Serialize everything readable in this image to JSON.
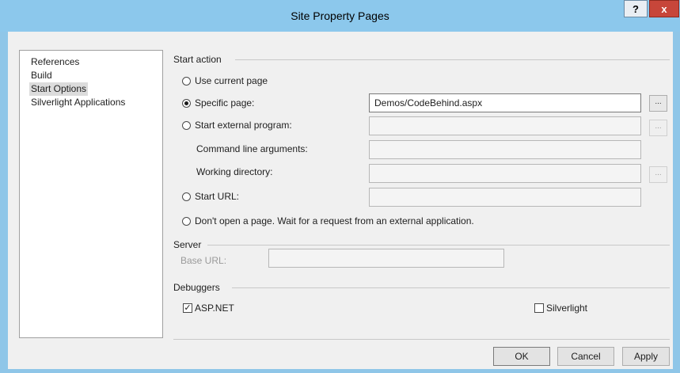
{
  "window": {
    "title": "Site Property Pages",
    "help_label": "?",
    "close_label": "x"
  },
  "nav": {
    "items": [
      {
        "label": "References"
      },
      {
        "label": "Build"
      },
      {
        "label": "Start Options",
        "selected": true
      },
      {
        "label": "Silverlight Applications"
      }
    ]
  },
  "start_action": {
    "group_title": "Start action",
    "use_current_page": {
      "label": "Use current page",
      "selected": false
    },
    "specific_page": {
      "label": "Specific page:",
      "selected": true,
      "value": "Demos/CodeBehind.aspx",
      "browse_label": "..."
    },
    "start_external_program": {
      "label": "Start external program:",
      "selected": false,
      "value": "",
      "browse_label": "..."
    },
    "command_line_arguments": {
      "label": "Command line arguments:",
      "value": ""
    },
    "working_directory": {
      "label": "Working directory:",
      "value": "",
      "browse_label": "..."
    },
    "start_url": {
      "label": "Start URL:",
      "selected": false,
      "value": ""
    },
    "dont_open": {
      "label": "Don't open a page. Wait for a request from an external application.",
      "selected": false
    }
  },
  "server": {
    "group_title": "Server",
    "base_url_label": "Base URL:",
    "base_url_value": ""
  },
  "debuggers": {
    "group_title": "Debuggers",
    "aspnet": {
      "label": "ASP.NET",
      "checked": true,
      "mark": "✓"
    },
    "silverlight": {
      "label": "Silverlight",
      "checked": false
    }
  },
  "buttons": {
    "ok": "OK",
    "cancel": "Cancel",
    "apply": "Apply"
  }
}
